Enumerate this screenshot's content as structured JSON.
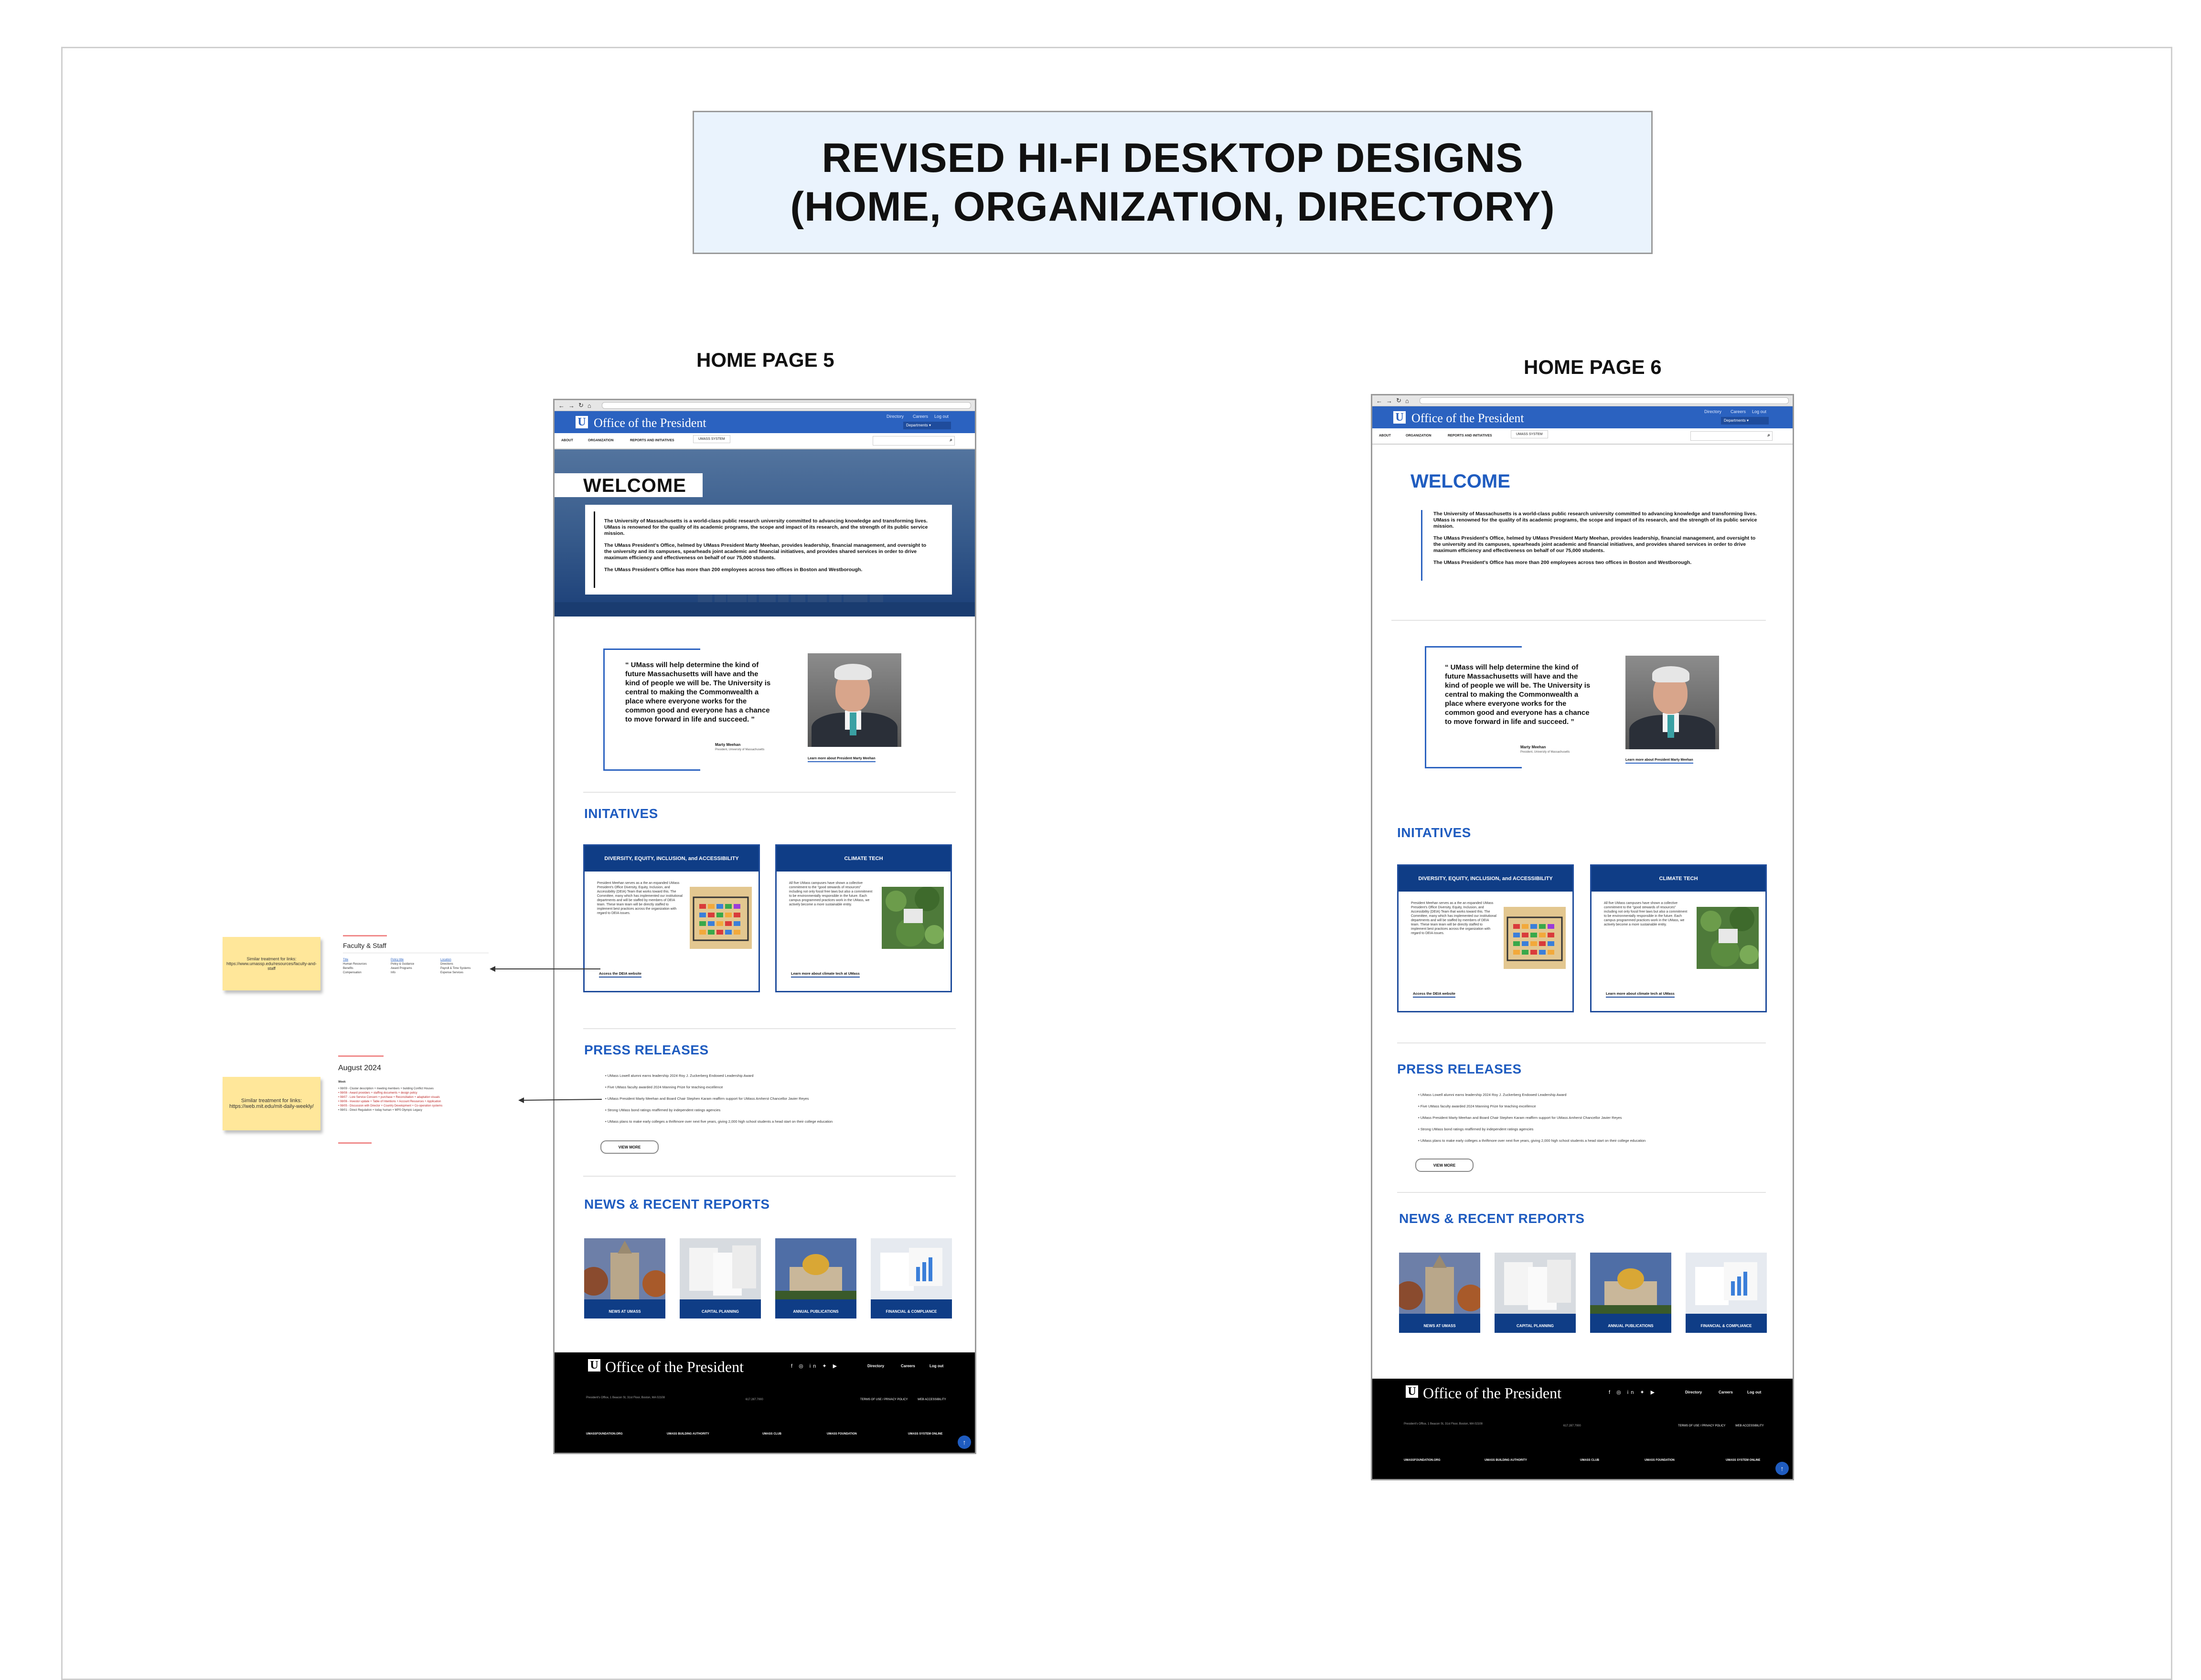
{
  "title_lines": [
    "REVISED HI-FI DESKTOP DESIGNS",
    "(HOME, ORGANIZATION, DIRECTORY)"
  ],
  "artboards": {
    "left_label": "HOME PAGE 5",
    "right_label": "HOME PAGE 6"
  },
  "site": {
    "title": "Office of the President",
    "logo_letter": "U",
    "utility_links": [
      "Directory",
      "Careers",
      "Log out"
    ],
    "departments": "Departments",
    "nav": [
      "ABOUT",
      "ORGANIZATION",
      "REPORTS AND INITIATIVES"
    ],
    "nav_system": "UMASS SYSTEM",
    "search_icon": "search-icon",
    "welcome": "WELCOME",
    "intro": [
      "The University of Massachusetts is a world-class public research university committed to advancing knowledge and transforming lives. UMass is renowned for the quality of its academic programs, the scope and impact of its research, and the strength of its public service mission.",
      "The UMass President's Office, helmed by UMass President Marty Meehan, provides leadership, financial management, and oversight to the university and its campuses, spearheads joint academic and financial initiatives, and provides shared services in order to drive maximum efficiency and effectiveness on behalf of our 75,000 students.",
      "The UMass President's Office has more than 200 employees across two offices in Boston and Westborough."
    ],
    "quote": "UMass will help determine the kind of future Massachusetts will have and the kind of people we will be. The University is central to making the Commonwealth a place where everyone works for the common good and everyone has a chance to move forward in life and succeed.",
    "quote_name": "Marty Meehan",
    "quote_title": "President, University of Massachusetts",
    "quote_link": "Learn more about President Marty Meehan",
    "initiatives_heading": "INITATIVES",
    "cards": [
      {
        "title": "DIVERSITY, EQUITY, INCLUSION, and ACCESSIBILITY",
        "body": "President Meehan serves as a the an expanded UMass President's Office Diversity, Equity, Inclusion, and Accessibility (DEIA) Team that works toward this. The Committee, many which has implemented our institutional departments and will be staffed by members of DEIA team. These team team will be directly staffed to implement best practices across the organization with regard to DEIA issues.",
        "link": "Access the DEIA website"
      },
      {
        "title": "CLIMATE TECH",
        "body": "All five UMass campuses have shown a collective commitment to the \"good stewards of resources\" including not only fossil free laws but also a commitment to be environmentally responsible in the future. Each campus programmed practices work in the UMass, we actively become a more sustainable entity.",
        "link": "Learn more about climate tech at UMass"
      }
    ],
    "press_heading": "PRESS RELEASES",
    "press": [
      "UMass Lowell alumni earns leadership 2024 Roy J. Zuckerberg Endowed Leadership Award",
      "Five UMass faculty awarded 2024 Manning Prize for teaching excellence",
      "UMass President Marty Meehan and Board Chair Stephen Karam reaffirm support for UMass Amherst Chancellor Javier Reyes",
      "Strong UMass bond ratings reaffirmed by independent ratings agencies",
      "UMass plans to make early colleges a thriftmore over next five years, giving 2,000 high school students a head start on their college education"
    ],
    "view_more": "VIEW MORE",
    "news_heading": "NEWS & RECENT REPORTS",
    "tiles": [
      "NEWS AT UMASS",
      "CAPITAL PLANNING",
      "ANNUAL PUBLICATIONS",
      "FINANCIAL & COMPLIANCE"
    ],
    "footer": {
      "social_icons": "f ◎ in ✦ ▶",
      "links": [
        "Directory",
        "Careers",
        "Log out"
      ],
      "address": "President's Office, 1 Beacon St, 31st Floor, Boston, MA 02108",
      "phone": "617.287.7000",
      "legal": [
        "TERMS OF USE / PRIVACY POLICY",
        "WEB ACCESSIBILITY"
      ],
      "bottom": [
        "UMASSFOUNDATION.ORG",
        "UMASS BUILDING AUTHORITY",
        "UMASS CLUB",
        "UMASS FOUNDATION",
        "UMASS SYSTEM ONLINE"
      ],
      "top_icon": "arrow-up-icon"
    }
  },
  "annotations": {
    "sticky1": "Similar treatment for links: https://www.umassp.edu/resources/faculty-and-staff",
    "sticky2": "Similar treatment for links: https://web.mit.edu/mit-daily-weekly/",
    "faculty_title": "Faculty & Staff",
    "faculty_cols": [
      [
        "Title",
        "Human Resources",
        "Benefits",
        "Compensation"
      ],
      [
        "Policy title",
        "Policy & Guidance",
        "Award Programs",
        "Info"
      ],
      [
        "Location",
        "Directions",
        "Payroll & Time Systems",
        "Expense Services"
      ]
    ],
    "august_title": "August 2024",
    "august_sub": "Week",
    "august_items": [
      "08/09 - Cluster description + meeting members + building Conflict Houses",
      "08/08 - Award providers + staffing documents + design policy",
      "08/07 - Lore Service Concern + purchase + Reconciliation + adaptation visuals",
      "08/06 - Investor update + Table of Intentions + Account Resources + Application",
      "08/05 - Discussion with Director + Country Development + Co-operation systems",
      "08/01 - Direct Regulation + today human + MPS Olympic Legacy"
    ]
  },
  "colors": {
    "brand_blue": "#2b62c0",
    "navy": "#0f3d86",
    "heading_blue": "#1f5cc0",
    "title_bg": "#eaf3fd",
    "sticky": "#ffe79a"
  }
}
